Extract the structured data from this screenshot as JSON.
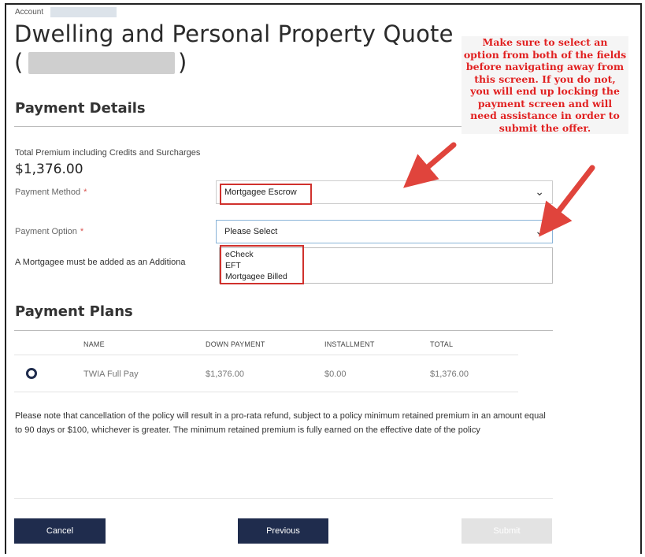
{
  "account_label": "Account",
  "title": {
    "line1": "Dwelling and Personal Property Quote",
    "open_paren": "(",
    "close_paren": ")"
  },
  "payment_details": {
    "heading": "Payment Details",
    "premium_label": "Total Premium including Credits and Surcharges",
    "premium_value": "$1,376.00",
    "payment_method_label": "Payment Method",
    "payment_method_value": "Mortgagee Escrow",
    "payment_option_label": "Payment Option",
    "payment_option_value": "Please Select",
    "required_marker": "*",
    "mortgagee_note": "A Mortgagee must be added as an Additiona",
    "payment_option_choices": [
      "eCheck",
      "EFT",
      "Mortgagee Billed"
    ]
  },
  "payment_plans": {
    "heading": "Payment Plans",
    "columns": [
      "NAME",
      "DOWN PAYMENT",
      "INSTALLMENT",
      "TOTAL"
    ],
    "rows": [
      {
        "name": "TWIA Full Pay",
        "down_payment": "$1,376.00",
        "installment": "$0.00",
        "total": "$1,376.00"
      }
    ]
  },
  "cancellation_note": "Please note that cancellation of the policy will result in a pro-rata refund, subject to a policy minimum retained premium in an amount equal to 90 days or $100, whichever is greater. The minimum retained premium is fully earned on the effective date of the policy",
  "buttons": {
    "cancel": "Cancel",
    "previous": "Previous",
    "submit": "Submit"
  },
  "annotation": "Make sure to select an option from both of the fields before navigating away from this screen. If you do not, you will end up locking the payment screen and will need assistance in order to submit the offer.",
  "colors": {
    "primary": "#1f2c4d",
    "annotation_red": "#e02020",
    "required_red": "#d9534f",
    "disabled": "#e3e3e3"
  }
}
